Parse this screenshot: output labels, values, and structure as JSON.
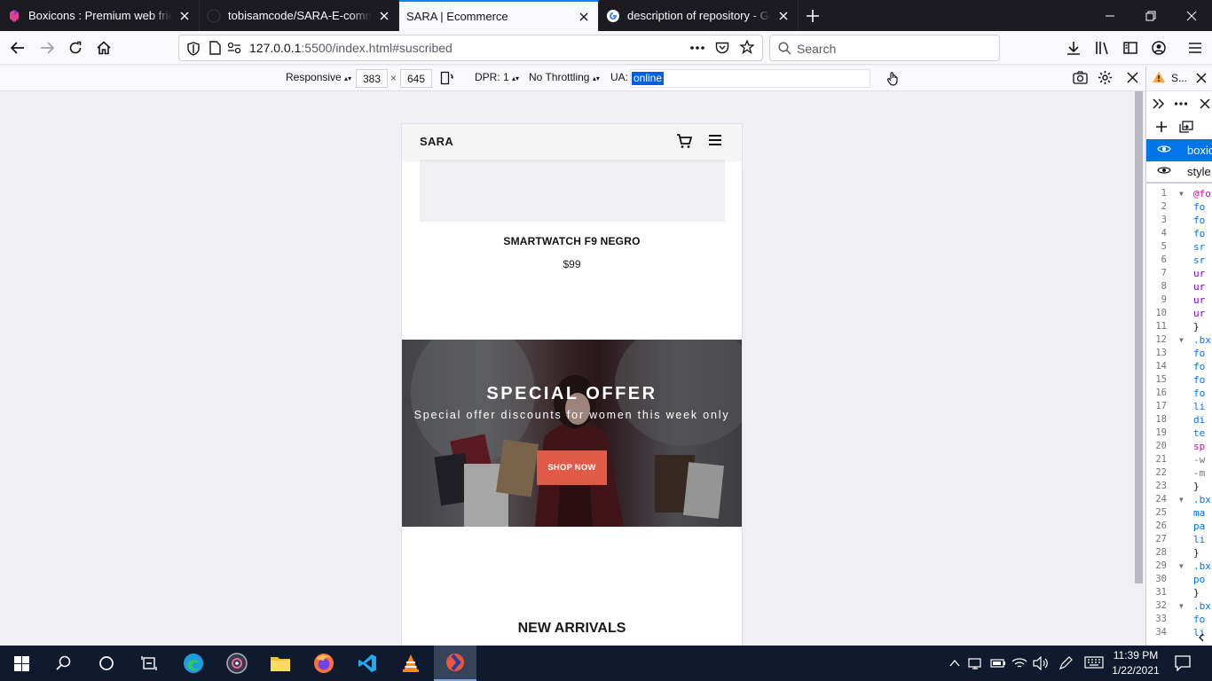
{
  "tabs": [
    {
      "title": "Boxicons : Premium web friend",
      "active": false
    },
    {
      "title": "tobisamcode/SARA-E-commer",
      "active": false
    },
    {
      "title": "SARA | Ecommerce",
      "active": true
    },
    {
      "title": "description of repository - Goo",
      "active": false
    }
  ],
  "nav": {
    "url_host": "127.0.0.1",
    "url_rest": ":5500/index.html#suscribed",
    "search_placeholder": "Search"
  },
  "rdm": {
    "device": "Responsive",
    "width": "383",
    "times": "×",
    "height": "645",
    "dpr": "DPR: 1",
    "throttling": "No Throttling",
    "ua_label": "UA:",
    "ua_value": "online"
  },
  "devtools": {
    "title": "S...",
    "sheets": [
      "boxic",
      "style."
    ],
    "lines": [
      {
        "n": "1",
        "t": "@fo",
        "tw": true,
        "c": "#dd00a9"
      },
      {
        "n": "2",
        "t": "fo",
        "c": "#0074e8"
      },
      {
        "n": "3",
        "t": "fo",
        "c": "#0074e8"
      },
      {
        "n": "4",
        "t": "fo",
        "c": "#0074e8"
      },
      {
        "n": "5",
        "t": "sr",
        "c": "#0074e8"
      },
      {
        "n": "6",
        "t": "sr",
        "c": "#0074e8"
      },
      {
        "n": "7",
        "t": "ur",
        "c": "#8000d7"
      },
      {
        "n": "8",
        "t": "ur",
        "c": "#8000d7"
      },
      {
        "n": "9",
        "t": "ur",
        "c": "#8000d7"
      },
      {
        "n": "10",
        "t": "ur",
        "c": "#8000d7"
      },
      {
        "n": "11",
        "t": "}",
        "c": "#15141a"
      },
      {
        "n": "12",
        "t": ".bx",
        "tw": true,
        "c": "#0074e8"
      },
      {
        "n": "13",
        "t": "fo",
        "c": "#0074e8"
      },
      {
        "n": "14",
        "t": "fo",
        "c": "#0074e8"
      },
      {
        "n": "15",
        "t": "fo",
        "c": "#0074e8"
      },
      {
        "n": "16",
        "t": "fo",
        "c": "#0074e8"
      },
      {
        "n": "17",
        "t": "li",
        "c": "#0074e8"
      },
      {
        "n": "18",
        "t": "di",
        "c": "#0074e8"
      },
      {
        "n": "19",
        "t": "te",
        "c": "#0074e8"
      },
      {
        "n": "20",
        "t": "sp",
        "c": "#dd00a9"
      },
      {
        "n": "21",
        "t": "-w",
        "c": "#737373"
      },
      {
        "n": "22",
        "t": "-m",
        "c": "#737373"
      },
      {
        "n": "23",
        "t": "}",
        "c": "#15141a"
      },
      {
        "n": "24",
        "t": ".bx",
        "tw": true,
        "c": "#0074e8"
      },
      {
        "n": "25",
        "t": "ma",
        "c": "#0074e8"
      },
      {
        "n": "26",
        "t": "pa",
        "c": "#0074e8"
      },
      {
        "n": "27",
        "t": "li",
        "c": "#0074e8"
      },
      {
        "n": "28",
        "t": "}",
        "c": "#15141a"
      },
      {
        "n": "29",
        "t": ".bx",
        "tw": true,
        "c": "#0074e8"
      },
      {
        "n": "30",
        "t": "po",
        "c": "#0074e8"
      },
      {
        "n": "31",
        "t": "}",
        "c": "#15141a"
      },
      {
        "n": "32",
        "t": ".bx",
        "tw": true,
        "c": "#0074e8"
      },
      {
        "n": "33",
        "t": "fo",
        "c": "#0074e8"
      },
      {
        "n": "34",
        "t": "li",
        "c": "#0074e8"
      }
    ]
  },
  "page": {
    "logo": "SARA",
    "product_name": "SMARTWATCH F9 NEGRO",
    "product_price": "$99",
    "offer_title": "SPECIAL OFFER",
    "offer_subtitle": "Special offer discounts for women this week only",
    "offer_button": "SHOP NOW",
    "arrivals_title": "NEW ARRIVALS",
    "accent_color": "#e05a47"
  },
  "taskbar": {
    "time": "11:39 PM",
    "date": "1/22/2021"
  }
}
